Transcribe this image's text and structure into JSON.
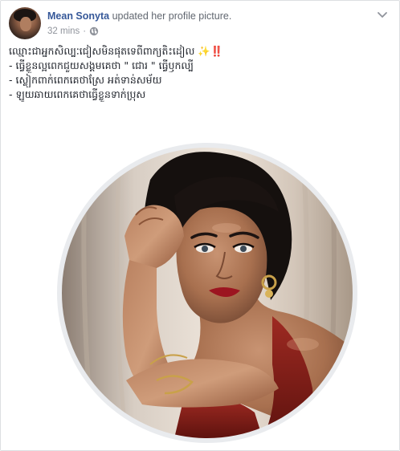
{
  "post": {
    "author": "Mean Sonyta",
    "action": "updated her profile picture.",
    "time": "32 mins",
    "separator": "·",
    "privacy_icon": "globe-icon",
    "menu_icon": "chevron-down-icon",
    "text_lines": [
      "ឈ្មោះជាអ្នកសិល្បៈជៀសមិនផុតទេពីពាក្យតិះដៀល",
      "- ធ្វើខ្លួនល្អពេកជួយសង្គមគេថា \" ជោរ \" ធ្វើឫកល្បី",
      "- ស្លៀកពាក់ពេកគេថាស្រែ អត់ទាន់សម័យ",
      "- ឡូយឆាយពេកគេថាធ្វើខ្លួនទាក់ប្រុស"
    ],
    "emoji_sparkle": "✨",
    "emoji_bang": "‼️"
  },
  "photo": {
    "subject": "profile picture of woman in red dress",
    "shape": "circle"
  },
  "colors": {
    "link": "#365899",
    "meta": "#90949c",
    "text": "#1d2129",
    "border": "#dddfe2"
  }
}
